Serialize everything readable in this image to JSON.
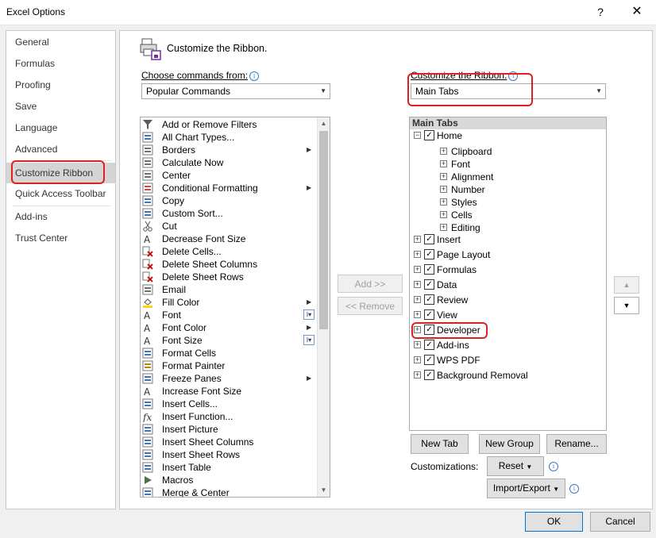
{
  "window": {
    "title": "Excel Options",
    "help_glyph": "?",
    "close_glyph": "✕"
  },
  "nav": [
    {
      "label": "General"
    },
    {
      "label": "Formulas"
    },
    {
      "label": "Proofing"
    },
    {
      "label": "Save"
    },
    {
      "label": "Language"
    },
    {
      "label": "Advanced"
    },
    {
      "label": "Customize Ribbon"
    },
    {
      "label": "Quick Access Toolbar"
    },
    {
      "label": "Add-ins"
    },
    {
      "label": "Trust Center"
    }
  ],
  "header": {
    "title": "Customize the Ribbon."
  },
  "left": {
    "label": "Choose commands from:",
    "combo_value": "Popular Commands",
    "commands": [
      {
        "label": "Add or Remove Filters",
        "icon": "filter-icon"
      },
      {
        "label": "All Chart Types...",
        "icon": "chart-icon"
      },
      {
        "label": "Borders",
        "icon": "borders-icon",
        "submenu": true
      },
      {
        "label": "Calculate Now",
        "icon": "calculator-icon"
      },
      {
        "label": "Center",
        "icon": "center-align-icon"
      },
      {
        "label": "Conditional Formatting",
        "icon": "conditional-format-icon",
        "submenu": true
      },
      {
        "label": "Copy",
        "icon": "copy-icon"
      },
      {
        "label": "Custom Sort...",
        "icon": "sort-icon"
      },
      {
        "label": "Cut",
        "icon": "scissors-icon"
      },
      {
        "label": "Decrease Font Size",
        "icon": "decrease-font-icon"
      },
      {
        "label": "Delete Cells...",
        "icon": "delete-cells-icon"
      },
      {
        "label": "Delete Sheet Columns",
        "icon": "delete-columns-icon"
      },
      {
        "label": "Delete Sheet Rows",
        "icon": "delete-rows-icon"
      },
      {
        "label": "Email",
        "icon": "email-icon"
      },
      {
        "label": "Fill Color",
        "icon": "fill-color-icon",
        "submenu": true
      },
      {
        "label": "Font",
        "icon": "font-icon",
        "fontctrl": true
      },
      {
        "label": "Font Color",
        "icon": "font-color-icon",
        "submenu": true
      },
      {
        "label": "Font Size",
        "icon": "font-size-icon",
        "fontctrl": true
      },
      {
        "label": "Format Cells",
        "icon": "format-cells-icon"
      },
      {
        "label": "Format Painter",
        "icon": "format-painter-icon"
      },
      {
        "label": "Freeze Panes",
        "icon": "freeze-panes-icon",
        "submenu": true
      },
      {
        "label": "Increase Font Size",
        "icon": "increase-font-icon"
      },
      {
        "label": "Insert Cells...",
        "icon": "insert-cells-icon"
      },
      {
        "label": "Insert Function...",
        "icon": "function-icon"
      },
      {
        "label": "Insert Picture",
        "icon": "picture-icon"
      },
      {
        "label": "Insert Sheet Columns",
        "icon": "insert-columns-icon"
      },
      {
        "label": "Insert Sheet Rows",
        "icon": "insert-rows-icon"
      },
      {
        "label": "Insert Table",
        "icon": "table-icon"
      },
      {
        "label": "Macros",
        "icon": "macros-icon"
      },
      {
        "label": "Merge & Center",
        "icon": "merge-center-icon"
      }
    ]
  },
  "middle": {
    "add_label": "Add >>",
    "remove_label": "<< Remove"
  },
  "right": {
    "label": "Customize the Ribbon:",
    "combo_value": "Main Tabs",
    "tree_header": "Main Tabs",
    "home": {
      "label": "Home",
      "groups": [
        "Clipboard",
        "Font",
        "Alignment",
        "Number",
        "Styles",
        "Cells",
        "Editing"
      ]
    },
    "tabs": [
      {
        "label": "Insert"
      },
      {
        "label": "Page Layout"
      },
      {
        "label": "Formulas"
      },
      {
        "label": "Data"
      },
      {
        "label": "Review"
      },
      {
        "label": "View"
      },
      {
        "label": "Developer"
      },
      {
        "label": "Add-ins"
      },
      {
        "label": "WPS PDF"
      },
      {
        "label": "Background Removal"
      }
    ],
    "new_tab": "New Tab",
    "new_group": "New Group",
    "rename": "Rename...",
    "customizations_label": "Customizations:",
    "reset": "Reset",
    "import_export": "Import/Export"
  },
  "footer": {
    "ok": "OK",
    "cancel": "Cancel"
  },
  "colors": {
    "highlight": "#e02020",
    "selected_nav": "#d5d5d5"
  }
}
